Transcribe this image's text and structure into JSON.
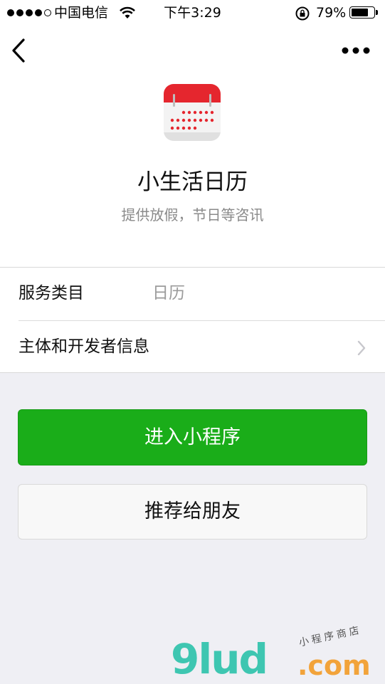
{
  "status_bar": {
    "carrier": "中国电信",
    "time": "下午3:29",
    "battery_percent": "79%",
    "battery_level": 0.79,
    "signal_bars_filled": 4,
    "signal_bars_total": 5
  },
  "nav": {
    "back_icon": "chevron-left-icon",
    "more_icon": "ellipsis-icon"
  },
  "app": {
    "icon": "calendar-icon",
    "name": "小生活日历",
    "description": "提供放假，节日等咨讯"
  },
  "info": {
    "category_label": "服务类目",
    "category_value": "日历",
    "developer_label": "主体和开发者信息"
  },
  "actions": {
    "enter_label": "进入小程序",
    "share_label": "推荐给朋友"
  },
  "colors": {
    "primary_green": "#1aad19",
    "calendar_red": "#e5262e"
  },
  "watermark": {
    "logo": "9lud",
    "domain": ".com",
    "tagline": "小程序商店"
  }
}
